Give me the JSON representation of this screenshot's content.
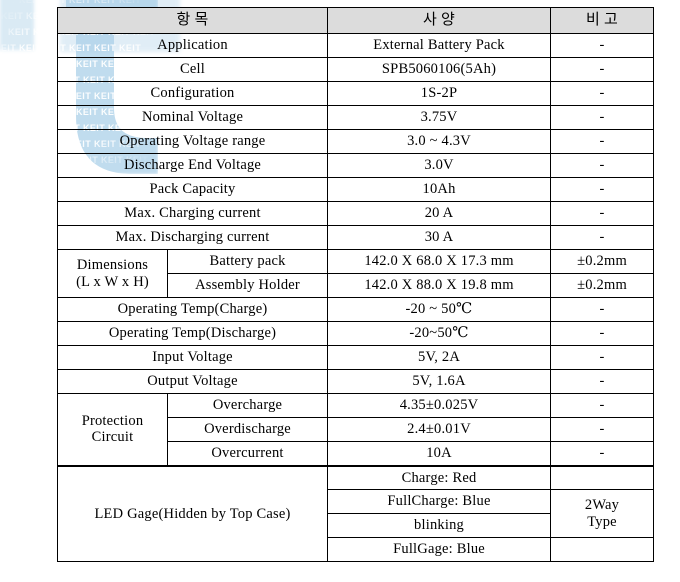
{
  "watermark": {
    "text": "KEIT",
    "repeat_line": "KEIT KEIT KEIT KEIT KEIT KEIT",
    "color": "#a8cfe8"
  },
  "table": {
    "header": {
      "item": "항 목",
      "spec": "사 양",
      "remark": "비 고"
    },
    "colors": {
      "header_bg": "#dcdcdc",
      "border": "#000000",
      "text": "#000000"
    },
    "rows": [
      {
        "label": "Application",
        "spec": "External Battery Pack",
        "remark": "-"
      },
      {
        "label": "Cell",
        "spec": "SPB5060106(5Ah)",
        "remark": "-"
      },
      {
        "label": "Configuration",
        "spec": "1S-2P",
        "remark": "-"
      },
      {
        "label": "Nominal Voltage",
        "spec": "3.75V",
        "remark": "-"
      },
      {
        "label": "Operating Voltage range",
        "spec": "3.0 ~ 4.3V",
        "remark": "-"
      },
      {
        "label": "Discharge End Voltage",
        "spec": "3.0V",
        "remark": "-"
      },
      {
        "label": "Pack Capacity",
        "spec": "10Ah",
        "remark": "-"
      },
      {
        "label": "Max. Charging current",
        "spec": "20 A",
        "remark": "-"
      },
      {
        "label": "Max. Discharging current",
        "spec": "30 A",
        "remark": "-"
      }
    ],
    "dimensions": {
      "label_line1": "Dimensions",
      "label_line2": "(L x W x H)",
      "sub_rows": [
        {
          "sub": "Battery pack",
          "spec": "142.0 X 68.0 X 17.3 mm",
          "remark": "±0.2mm"
        },
        {
          "sub": "Assembly Holder",
          "spec": "142.0 X 88.0 X 19.8 mm",
          "remark": "±0.2mm"
        }
      ]
    },
    "rows2": [
      {
        "label": "Operating Temp(Charge)",
        "spec": "-20 ~ 50℃",
        "remark": "-"
      },
      {
        "label": "Operating Temp(Discharge)",
        "spec": "-20~50℃",
        "remark": "-"
      },
      {
        "label": "Input Voltage",
        "spec": "5V, 2A",
        "remark": "-"
      },
      {
        "label": "Output Voltage",
        "spec": "5V, 1.6A",
        "remark": "-"
      }
    ],
    "protection": {
      "label_line1": "Protection",
      "label_line2": "Circuit",
      "sub_rows": [
        {
          "sub": "Overcharge",
          "spec": "4.35±0.025V",
          "remark": "-"
        },
        {
          "sub": "Overdischarge",
          "spec": "2.4±0.01V",
          "remark": "-"
        },
        {
          "sub": "Overcurrent",
          "spec": "10A",
          "remark": "-"
        }
      ]
    },
    "led": {
      "label": "LED Gage(Hidden by Top Case)",
      "spec_rows": [
        "Charge:  Red",
        "FullCharge:  Blue",
        "blinking",
        "FullGage:   Blue"
      ],
      "remark_line1": "2Way",
      "remark_line2": "Type"
    }
  }
}
